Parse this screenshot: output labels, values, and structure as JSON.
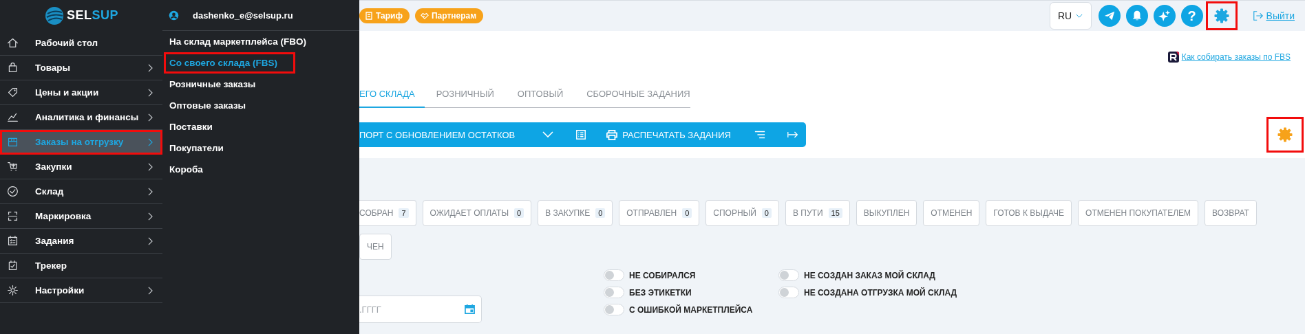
{
  "sidebar": {
    "logo": {
      "parts": [
        {
          "text": "SEL",
          "color": "#ffffff"
        },
        {
          "text": "SUP",
          "color": "#1ea7e1"
        }
      ]
    },
    "items": [
      {
        "label": "Рабочий стол",
        "kind": "home",
        "has_submenu": false,
        "selected": false,
        "highlighted": false
      },
      {
        "label": "Товары",
        "kind": "bag",
        "has_submenu": true,
        "selected": false,
        "highlighted": false
      },
      {
        "label": "Цены и акции",
        "kind": "tag",
        "has_submenu": true,
        "selected": false,
        "highlighted": false
      },
      {
        "label": "Аналитика и финансы",
        "kind": "chart",
        "has_submenu": true,
        "selected": false,
        "highlighted": false
      },
      {
        "label": "Заказы на отгрузку",
        "kind": "box",
        "has_submenu": true,
        "selected": true,
        "highlighted": true
      },
      {
        "label": "Закупки",
        "kind": "cart",
        "has_submenu": true,
        "selected": false,
        "highlighted": false
      },
      {
        "label": "Склад",
        "kind": "check",
        "has_submenu": true,
        "selected": false,
        "highlighted": false
      },
      {
        "label": "Маркировка",
        "kind": "scan",
        "has_submenu": true,
        "selected": false,
        "highlighted": false
      },
      {
        "label": "Задания",
        "kind": "tasks",
        "has_submenu": true,
        "selected": false,
        "highlighted": false
      },
      {
        "label": "Трекер",
        "kind": "tracker",
        "has_submenu": false,
        "selected": false,
        "highlighted": false
      },
      {
        "label": "Настройки",
        "kind": "settings",
        "has_submenu": true,
        "selected": false,
        "highlighted": false
      }
    ]
  },
  "submenu": {
    "user": "dashenko_e@selsup.ru",
    "items": [
      {
        "label": "На склад маркетплейса (FBO)",
        "selected": false,
        "highlighted": false
      },
      {
        "label": "Со своего склада (FBS)",
        "selected": true,
        "highlighted": true
      },
      {
        "label": "Розничные заказы",
        "selected": false,
        "highlighted": false
      },
      {
        "label": "Оптовые заказы",
        "selected": false,
        "highlighted": false
      },
      {
        "label": "Поставки",
        "selected": false,
        "highlighted": false
      },
      {
        "label": "Покупатели",
        "selected": false,
        "highlighted": false
      },
      {
        "label": "Короба",
        "selected": false,
        "highlighted": false
      }
    ]
  },
  "top_bar": {
    "badges": [
      {
        "label": "Тариф",
        "kind": "tariff"
      },
      {
        "label": "Партнерам",
        "kind": "partners"
      }
    ],
    "language": "RU",
    "icon_buttons": [
      {
        "kind": "telegram",
        "highlighted": false
      },
      {
        "kind": "bell",
        "highlighted": false
      },
      {
        "kind": "sparkle",
        "highlighted": false
      },
      {
        "kind": "help",
        "label": "?",
        "highlighted": false
      },
      {
        "kind": "settings",
        "highlighted": true
      }
    ],
    "logout": "Выйти"
  },
  "help_link": "Как собирать заказы по FBS",
  "tabs": [
    {
      "label": "ЕГО СКЛАДА",
      "selected": true
    },
    {
      "label": "РОЗНИЧНЫЙ",
      "selected": false
    },
    {
      "label": "ОПТОВЫЙ",
      "selected": false
    },
    {
      "label": "СБОРОЧНЫЕ ЗАДАНИЯ",
      "selected": false
    }
  ],
  "toolbar": [
    {
      "kind": "text",
      "label": "ПОРТ С ОБНОВЛЕНИЕМ ОСТАТКОВ"
    },
    {
      "kind": "chevron"
    },
    {
      "kind": "list"
    },
    {
      "kind": "print",
      "label": "РАСПЕЧАТАТЬ ЗАДАНИЯ"
    },
    {
      "kind": "lines"
    },
    {
      "kind": "arrow"
    }
  ],
  "settings_button": {
    "highlighted": true
  },
  "status_chips": [
    {
      "label": "СОБРАН",
      "count": "7"
    },
    {
      "label": "ОЖИДАЕТ ОПЛАТЫ",
      "count": "0"
    },
    {
      "label": "В ЗАКУПКЕ",
      "count": "0"
    },
    {
      "label": "ОТПРАВЛЕН",
      "count": "0"
    },
    {
      "label": "СПОРНЫЙ",
      "count": "0"
    },
    {
      "label": "В ПУТИ",
      "count": "15"
    },
    {
      "label": "ВЫКУПЛЕН"
    },
    {
      "label": "ОТМЕНЕН"
    },
    {
      "label": "ГОТОВ К ВЫДАЧЕ"
    },
    {
      "label": "ОТМЕНЕН ПОКУПАТЕЛЕМ"
    },
    {
      "label": "ВОЗВРАТ"
    },
    {
      "label": "ЧЕН"
    }
  ],
  "date_field": {
    "placeholder": ".ГГГГ"
  },
  "toggles": [
    {
      "label": "НЕ СОБИРАЛСЯ",
      "on": false
    },
    {
      "label": "НЕ СОЗДАН ЗАКАЗ МОЙ СКЛАД",
      "on": false
    },
    {
      "label": "БЕЗ ЭТИКЕТКИ",
      "on": false
    },
    {
      "label": "НЕ СОЗДАНА ОТГРУЗКА МОЙ СКЛАД",
      "on": false
    },
    {
      "label": "С ОШИБКОЙ МАРКЕТПЛЕЙСА",
      "on": false
    }
  ]
}
